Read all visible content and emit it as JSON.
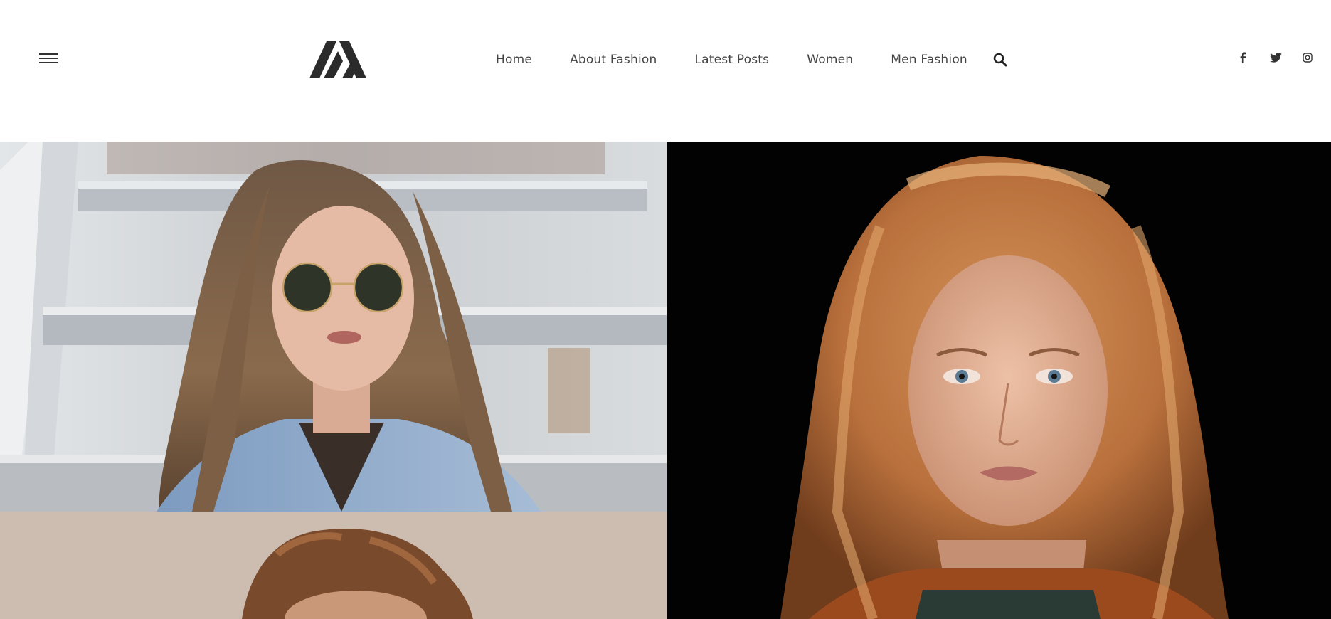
{
  "header": {
    "menu_icon": "hamburger-menu-icon",
    "logo_icon": "m-monogram-logo",
    "nav": [
      {
        "label": "Home"
      },
      {
        "label": "About Fashion"
      },
      {
        "label": "Latest Posts"
      },
      {
        "label": "Women"
      },
      {
        "label": "Men Fashion"
      }
    ],
    "search_icon": "search-icon",
    "social": [
      {
        "icon": "facebook-icon"
      },
      {
        "icon": "twitter-icon"
      },
      {
        "icon": "instagram-icon"
      }
    ]
  },
  "gallery": {
    "tiles": [
      {
        "subject": "woman-sunglasses-photo"
      },
      {
        "subject": "redhead-woman-portrait-photo"
      },
      {
        "subject": "curly-hair-person-photo"
      }
    ]
  },
  "colors": {
    "text": "#444444",
    "icon": "#333333",
    "background": "#ffffff",
    "dark_tile": "#000000"
  }
}
